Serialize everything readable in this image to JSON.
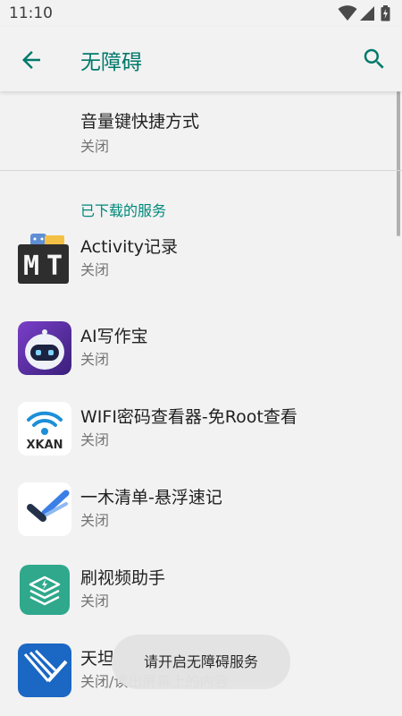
{
  "status_bar": {
    "time": "11:10",
    "icons": [
      "wifi-icon",
      "signal-icon",
      "battery-icon"
    ]
  },
  "app_bar": {
    "title": "无障碍",
    "back_icon": "arrow-back-icon",
    "search_icon": "search-icon"
  },
  "shortcut": {
    "title": "音量键快捷方式",
    "summary": "关闭"
  },
  "section": {
    "header": "已下载的服务"
  },
  "services": [
    {
      "name": "Activity记录",
      "status": "关闭",
      "icon": "mt-app-icon"
    },
    {
      "name": "AI写作宝",
      "status": "关闭",
      "icon": "robot-app-icon"
    },
    {
      "name": "WIFI密码查看器-免Root查看",
      "status": "关闭",
      "icon": "xkan-wifi-app-icon"
    },
    {
      "name": "一木清单-悬浮速记",
      "status": "关闭",
      "icon": "checkmark-app-icon"
    },
    {
      "name": "刷视频助手",
      "status": "关闭",
      "icon": "layers-bolt-app-icon"
    },
    {
      "name": "天坦",
      "status": "关闭/读出屏幕上的内容",
      "icon": "blue-stripes-app-icon"
    }
  ],
  "toast": {
    "text": "请开启无障碍服务"
  },
  "colors": {
    "accent": "#00796b",
    "section": "#00897b",
    "background": "#f2f2f2"
  }
}
